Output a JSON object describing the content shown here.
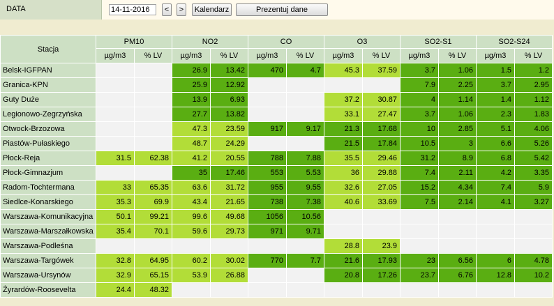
{
  "header": {
    "label": "DATA",
    "date_value": "14-11-2016",
    "prev_label": "<",
    "next_label": ">",
    "calendar_label": "Kalendarz",
    "present_label": "Prezentuj dane"
  },
  "table": {
    "station_header": "Stacja",
    "groups": [
      "PM10",
      "NO2",
      "CO",
      "O3",
      "SO2-S1",
      "SO2-S24"
    ],
    "unit_label": "µg/m3",
    "lv_label": "% LV",
    "colors": {
      "good": "#5aae12",
      "moderate": "#b2dd38",
      "empty": "#f2f2f2"
    },
    "rows": [
      {
        "name": "Belsk-IGFPAN",
        "cells": [
          [
            "",
            "",
            "e"
          ],
          [
            "26.9",
            "13.42",
            "g"
          ],
          [
            "470",
            "4.7",
            "g"
          ],
          [
            "45.3",
            "37.59",
            "l"
          ],
          [
            "3.7",
            "1.06",
            "g"
          ],
          [
            "1.5",
            "1.2",
            "g"
          ]
        ]
      },
      {
        "name": "Granica-KPN",
        "cells": [
          [
            "",
            "",
            "e"
          ],
          [
            "25.9",
            "12.92",
            "g"
          ],
          [
            "",
            "",
            "e"
          ],
          [
            "",
            "",
            "e"
          ],
          [
            "7.9",
            "2.25",
            "g"
          ],
          [
            "3.7",
            "2.95",
            "g"
          ]
        ]
      },
      {
        "name": "Guty Duże",
        "cells": [
          [
            "",
            "",
            "e"
          ],
          [
            "13.9",
            "6.93",
            "g"
          ],
          [
            "",
            "",
            "e"
          ],
          [
            "37.2",
            "30.87",
            "l"
          ],
          [
            "4",
            "1.14",
            "g"
          ],
          [
            "1.4",
            "1.12",
            "g"
          ]
        ]
      },
      {
        "name": "Legionowo-Zegrzyńska",
        "cells": [
          [
            "",
            "",
            "e"
          ],
          [
            "27.7",
            "13.82",
            "g"
          ],
          [
            "",
            "",
            "e"
          ],
          [
            "33.1",
            "27.47",
            "l"
          ],
          [
            "3.7",
            "1.06",
            "g"
          ],
          [
            "2.3",
            "1.83",
            "g"
          ]
        ]
      },
      {
        "name": "Otwock-Brzozowa",
        "cells": [
          [
            "",
            "",
            "e"
          ],
          [
            "47.3",
            "23.59",
            "l"
          ],
          [
            "917",
            "9.17",
            "g"
          ],
          [
            "21.3",
            "17.68",
            "g"
          ],
          [
            "10",
            "2.85",
            "g"
          ],
          [
            "5.1",
            "4.06",
            "g"
          ]
        ]
      },
      {
        "name": "Piastów-Pułaskiego",
        "cells": [
          [
            "",
            "",
            "e"
          ],
          [
            "48.7",
            "24.29",
            "l"
          ],
          [
            "",
            "",
            "e"
          ],
          [
            "21.5",
            "17.84",
            "g"
          ],
          [
            "10.5",
            "3",
            "g"
          ],
          [
            "6.6",
            "5.26",
            "g"
          ]
        ]
      },
      {
        "name": "Płock-Reja",
        "cells": [
          [
            "31.5",
            "62.38",
            "l"
          ],
          [
            "41.2",
            "20.55",
            "l"
          ],
          [
            "788",
            "7.88",
            "g"
          ],
          [
            "35.5",
            "29.46",
            "l"
          ],
          [
            "31.2",
            "8.9",
            "g"
          ],
          [
            "6.8",
            "5.42",
            "g"
          ]
        ]
      },
      {
        "name": "Płock-Gimnazjum",
        "cells": [
          [
            "",
            "",
            "e"
          ],
          [
            "35",
            "17.46",
            "g"
          ],
          [
            "553",
            "5.53",
            "g"
          ],
          [
            "36",
            "29.88",
            "l"
          ],
          [
            "7.4",
            "2.11",
            "g"
          ],
          [
            "4.2",
            "3.35",
            "g"
          ]
        ]
      },
      {
        "name": "Radom-Tochtermana",
        "cells": [
          [
            "33",
            "65.35",
            "l"
          ],
          [
            "63.6",
            "31.72",
            "l"
          ],
          [
            "955",
            "9.55",
            "g"
          ],
          [
            "32.6",
            "27.05",
            "l"
          ],
          [
            "15.2",
            "4.34",
            "g"
          ],
          [
            "7.4",
            "5.9",
            "g"
          ]
        ]
      },
      {
        "name": "Siedlce-Konarskiego",
        "cells": [
          [
            "35.3",
            "69.9",
            "l"
          ],
          [
            "43.4",
            "21.65",
            "l"
          ],
          [
            "738",
            "7.38",
            "g"
          ],
          [
            "40.6",
            "33.69",
            "l"
          ],
          [
            "7.5",
            "2.14",
            "g"
          ],
          [
            "4.1",
            "3.27",
            "g"
          ]
        ]
      },
      {
        "name": "Warszawa-Komunikacyjna",
        "cells": [
          [
            "50.1",
            "99.21",
            "l"
          ],
          [
            "99.6",
            "49.68",
            "l"
          ],
          [
            "1056",
            "10.56",
            "g"
          ],
          [
            "",
            "",
            "e"
          ],
          [
            "",
            "",
            "e"
          ],
          [
            "",
            "",
            "e"
          ]
        ]
      },
      {
        "name": "Warszawa-Marszałkowska",
        "cells": [
          [
            "35.4",
            "70.1",
            "l"
          ],
          [
            "59.6",
            "29.73",
            "l"
          ],
          [
            "971",
            "9.71",
            "g"
          ],
          [
            "",
            "",
            "e"
          ],
          [
            "",
            "",
            "e"
          ],
          [
            "",
            "",
            "e"
          ]
        ]
      },
      {
        "name": "Warszawa-Podleśna",
        "cells": [
          [
            "",
            "",
            "e"
          ],
          [
            "",
            "",
            "e"
          ],
          [
            "",
            "",
            "e"
          ],
          [
            "28.8",
            "23.9",
            "l"
          ],
          [
            "",
            "",
            "e"
          ],
          [
            "",
            "",
            "e"
          ]
        ]
      },
      {
        "name": "Warszawa-Targówek",
        "cells": [
          [
            "32.8",
            "64.95",
            "l"
          ],
          [
            "60.2",
            "30.02",
            "l"
          ],
          [
            "770",
            "7.7",
            "g"
          ],
          [
            "21.6",
            "17.93",
            "g"
          ],
          [
            "23",
            "6.56",
            "g"
          ],
          [
            "6",
            "4.78",
            "g"
          ]
        ]
      },
      {
        "name": "Warszawa-Ursynów",
        "cells": [
          [
            "32.9",
            "65.15",
            "l"
          ],
          [
            "53.9",
            "26.88",
            "l"
          ],
          [
            "",
            "",
            "e"
          ],
          [
            "20.8",
            "17.26",
            "g"
          ],
          [
            "23.7",
            "6.76",
            "g"
          ],
          [
            "12.8",
            "10.2",
            "g"
          ]
        ]
      },
      {
        "name": "Żyrardów-Roosevelta",
        "cells": [
          [
            "24.4",
            "48.32",
            "l"
          ],
          [
            "",
            "",
            "e"
          ],
          [
            "",
            "",
            "e"
          ],
          [
            "",
            "",
            "e"
          ],
          [
            "",
            "",
            "e"
          ],
          [
            "",
            "",
            "e"
          ]
        ]
      }
    ]
  }
}
